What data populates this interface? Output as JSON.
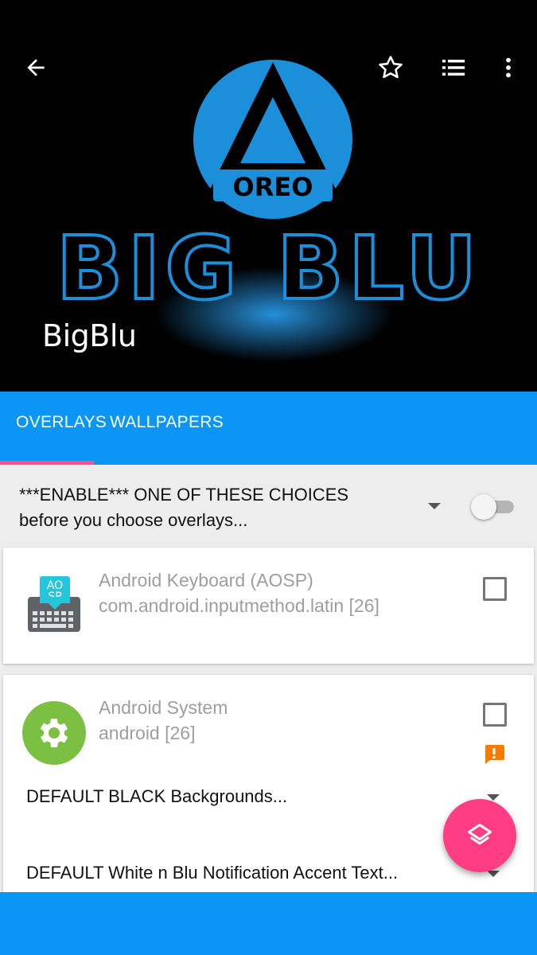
{
  "header": {
    "app_title": "BigBlu",
    "logo_text_top": "OREO",
    "logo_text_main": "BIG BLU",
    "actions": {
      "back_icon": "arrow-left",
      "favorite_icon": "star-outline",
      "list_icon": "list",
      "more_icon": "more-vertical"
    }
  },
  "tabs": [
    {
      "label": "OVERLAYS",
      "active": true
    },
    {
      "label": "WALLPAPERS",
      "active": false
    }
  ],
  "master": {
    "text": "***ENABLE*** ONE OF THESE CHOICES before you choose overlays...",
    "toggle_on": false
  },
  "cards": [
    {
      "name": "Android Keyboard (AOSP)",
      "package": "com.android.inputmethod.latin [26]",
      "icon": "keyboard-icon",
      "icon_text": "AO SP",
      "checked": false
    },
    {
      "name": "Android System",
      "package": "android [26]",
      "icon": "gear-icon",
      "checked": false,
      "warning": true,
      "options": [
        "DEFAULT BLACK Backgrounds...",
        "DEFAULT White n Blu Notification Accent Text..."
      ]
    }
  ],
  "fab": {
    "icon": "layers-icon"
  },
  "colors": {
    "accent": "#0b96f5",
    "fab": "#ff3d84",
    "tab_indicator": "#ff4d8d",
    "warning": "#f57c00",
    "gear_bg": "#7cc043"
  }
}
